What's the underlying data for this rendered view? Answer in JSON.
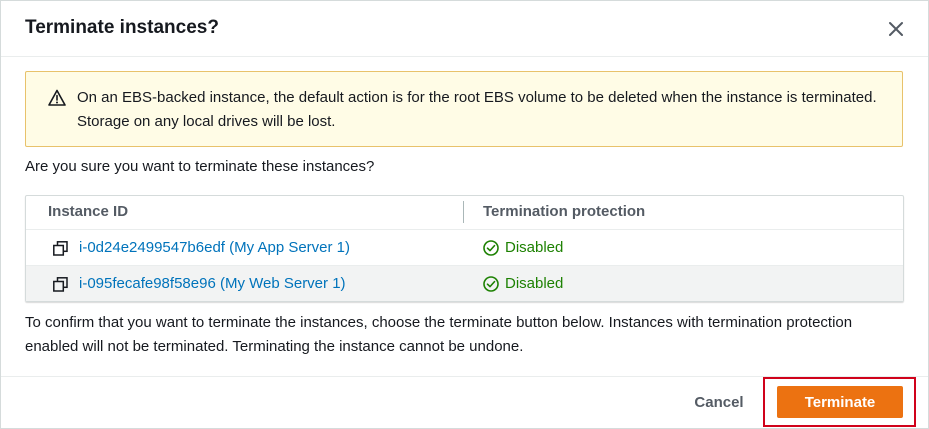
{
  "dialog": {
    "title": "Terminate instances?",
    "close_icon": "close-icon"
  },
  "warning": {
    "icon": "warning-triangle-icon",
    "text": "On an EBS-backed instance, the default action is for the root EBS volume to be deleted when the instance is terminated. Storage on any local drives will be lost."
  },
  "question": "Are you sure you want to terminate these instances?",
  "table": {
    "columns": [
      "Instance ID",
      "Termination protection"
    ],
    "rows": [
      {
        "instance": "i-0d24e2499547b6edf (My App Server 1)",
        "protection": "Disabled"
      },
      {
        "instance": "i-095fecafe98f58e96 (My Web Server 1)",
        "protection": "Disabled"
      }
    ]
  },
  "confirm_text": "To confirm that you want to terminate the instances, choose the terminate button below. Instances with termination protection enabled will not be terminated. Terminating the instance cannot be undone.",
  "footer": {
    "cancel_label": "Cancel",
    "terminate_label": "Terminate"
  },
  "colors": {
    "primary": "#ec7211",
    "link": "#0073bb",
    "success": "#1d8102",
    "warning_bg": "#fffce6",
    "highlight": "#d0021b"
  }
}
